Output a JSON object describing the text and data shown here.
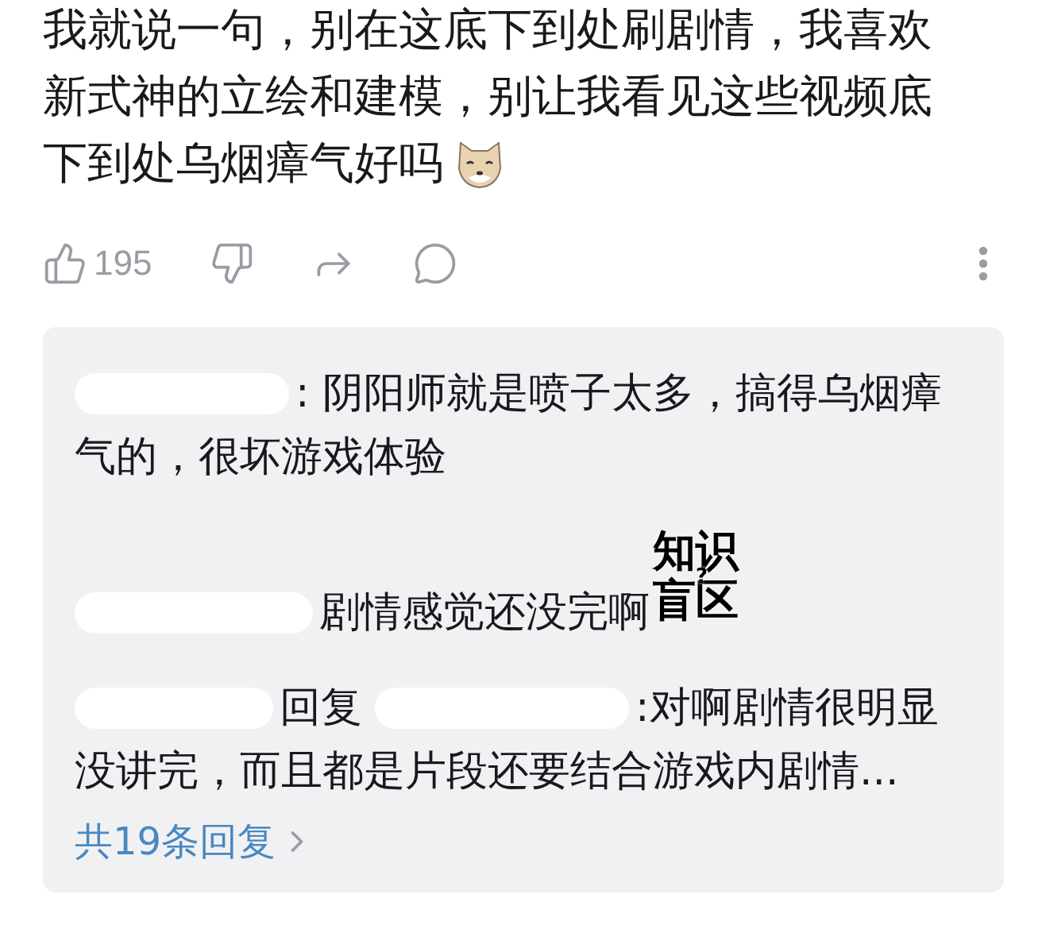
{
  "comment": {
    "lines": [
      "我就说一句，别在这底下到处刷剧情，我喜欢",
      "新式神的立绘和建模，别让我看见这些视频底",
      "下到处乌烟瘴气好吗"
    ],
    "like_count": "195"
  },
  "replies": [
    {
      "kind": "plain",
      "lines": [
        ": 阴阳师就是喷子太多，搞得乌烟瘴",
        "气的，很坏游戏体验"
      ]
    },
    {
      "kind": "plain",
      "lines": [
        "剧情感觉还没完啊"
      ]
    },
    {
      "kind": "reply_to",
      "reply_word": "回复",
      "lines": [
        ":对啊剧情很明显",
        "没讲完，而且都是片段还要结合游戏内剧情..."
      ]
    }
  ],
  "sticker": {
    "text": "知识盲区",
    "mark": "?"
  },
  "more_replies": "共19条回复"
}
